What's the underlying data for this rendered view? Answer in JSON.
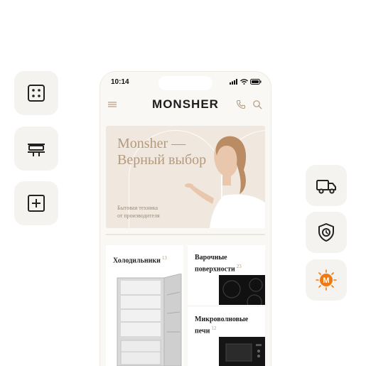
{
  "status_bar": {
    "time": "10:14"
  },
  "header": {
    "logo": "MONSHER"
  },
  "hero": {
    "title_line1": "Monsher —",
    "title_line2": "Верный выбор",
    "subtitle_line1": "Бытовая техника",
    "subtitle_line2": "от производителя"
  },
  "categories": [
    {
      "name": "Холодильники",
      "count": "13"
    },
    {
      "name_line1": "Варочные",
      "name_line2": "поверхности",
      "count": "23"
    },
    {
      "name_line1": "Микроволновые",
      "name_line2": "печи",
      "count": "12"
    }
  ],
  "badge": {
    "letter": "M"
  },
  "colors": {
    "accent": "#b49a7d",
    "badge": "#f07a12",
    "tile": "#f5f3f0"
  }
}
